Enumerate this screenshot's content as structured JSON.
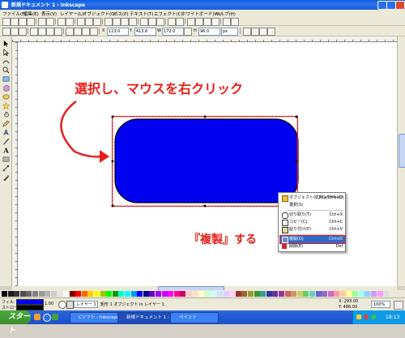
{
  "window": {
    "title": "新規ドキュメント 1 - Inkscape"
  },
  "menubar": {
    "items": [
      "ファイル(F)",
      "編集(E)",
      "表示(V)",
      "レイヤー(L)",
      "オブジェクト(O)",
      "パス(P)",
      "テキスト(T)",
      "エフェクト(C)",
      "ホワイトボード(W)",
      "ヘルプ(H)"
    ]
  },
  "toolcontrols": {
    "x_label": "X",
    "x_value": "113.0",
    "y_label": "Y",
    "y_value": "413.6",
    "w_label": "W",
    "w_value": "172.0",
    "h_label": "H",
    "h_value": "96.0",
    "units": "px"
  },
  "annotations": {
    "instruction": "選択し、マウスを右クリック",
    "duplicate_note": "『複製』する"
  },
  "context_menu": {
    "items": [
      {
        "label": "オブジェクトのプロパティ(O)",
        "shortcut": "Ctrl+Shift+O",
        "icon": "properties-icon"
      },
      {
        "label": "選択(S)",
        "shortcut": "",
        "icon": "select-icon"
      },
      {
        "label": "切り取り(T)",
        "shortcut": "Ctrl+X",
        "icon": "cut-icon"
      },
      {
        "label": "コピー(C)",
        "shortcut": "Ctrl+C",
        "icon": "copy-icon"
      },
      {
        "label": "貼り付け(P)",
        "shortcut": "Ctrl+V",
        "icon": "paste-icon"
      },
      {
        "label": "複製(D)",
        "shortcut": "Ctrl+D",
        "icon": "duplicate-icon",
        "highlighted": true
      },
      {
        "label": "削除(E)",
        "shortcut": "Del",
        "icon": "delete-icon"
      }
    ]
  },
  "statusbar": {
    "fill_label": "フィル:",
    "stroke_label": "ストローク:",
    "stroke_width": "1.00",
    "layer": "レイヤー 1",
    "message": "矩形 1 オブジェクト in レイヤー 1.",
    "zoom": "100%",
    "coords_x": "X: 293.00",
    "coords_y": "Y: 486.00"
  },
  "taskbar": {
    "start_label": "スタート",
    "tasks": [
      "Cソフト - Inkscape",
      "新規ドキュメント 1 - Ink...",
      "ペイント"
    ],
    "clock": "18:13"
  },
  "colors": {
    "shape_fill": "#0000f0",
    "selection_box": "#e02020",
    "annotation": "#e8201a",
    "menu_highlight": "#316ac5"
  }
}
